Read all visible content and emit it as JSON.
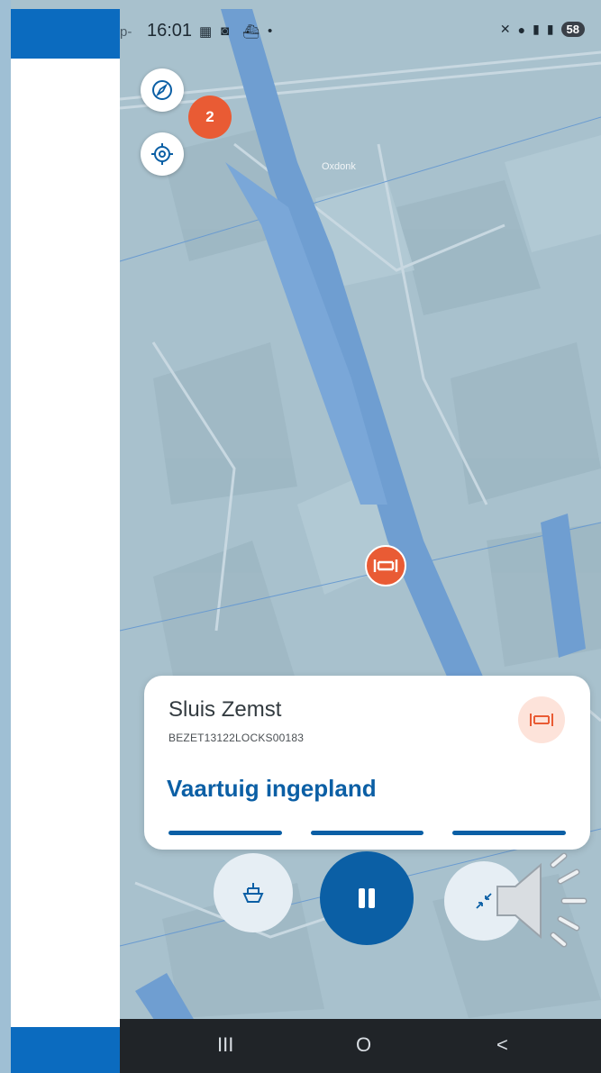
{
  "status_bar": {
    "prefix": "p-",
    "time": "16:01",
    "battery": "58"
  },
  "map": {
    "place_label": "Oxdonk",
    "cluster_count": "2"
  },
  "lock_card": {
    "title": "Sluis Zemst",
    "code": "BEZET13122LOCKS00183",
    "status": "Vaartuig ingepland"
  },
  "nav": {
    "recents": "III",
    "home": "O",
    "back": "<"
  },
  "colors": {
    "accent": "#0b5fa5",
    "marker": "#e95b34",
    "water": "#6f9ed1"
  }
}
